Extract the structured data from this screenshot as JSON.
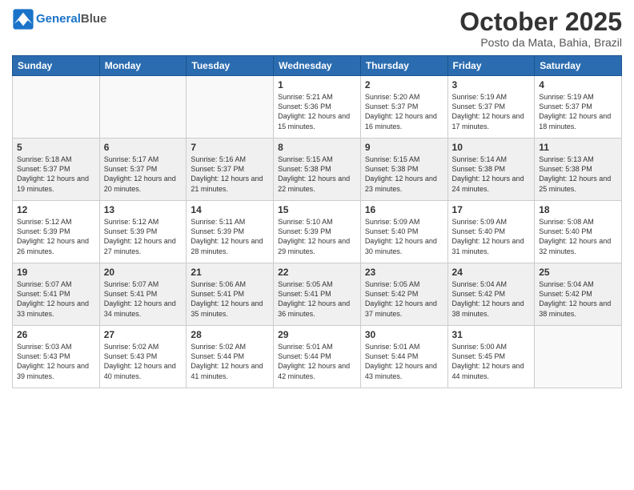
{
  "header": {
    "logo_line1": "General",
    "logo_line2": "Blue",
    "month": "October 2025",
    "location": "Posto da Mata, Bahia, Brazil"
  },
  "weekdays": [
    "Sunday",
    "Monday",
    "Tuesday",
    "Wednesday",
    "Thursday",
    "Friday",
    "Saturday"
  ],
  "weeks": [
    [
      {
        "day": "",
        "sunrise": "",
        "sunset": "",
        "daylight": ""
      },
      {
        "day": "",
        "sunrise": "",
        "sunset": "",
        "daylight": ""
      },
      {
        "day": "",
        "sunrise": "",
        "sunset": "",
        "daylight": ""
      },
      {
        "day": "1",
        "sunrise": "Sunrise: 5:21 AM",
        "sunset": "Sunset: 5:36 PM",
        "daylight": "Daylight: 12 hours and 15 minutes."
      },
      {
        "day": "2",
        "sunrise": "Sunrise: 5:20 AM",
        "sunset": "Sunset: 5:37 PM",
        "daylight": "Daylight: 12 hours and 16 minutes."
      },
      {
        "day": "3",
        "sunrise": "Sunrise: 5:19 AM",
        "sunset": "Sunset: 5:37 PM",
        "daylight": "Daylight: 12 hours and 17 minutes."
      },
      {
        "day": "4",
        "sunrise": "Sunrise: 5:19 AM",
        "sunset": "Sunset: 5:37 PM",
        "daylight": "Daylight: 12 hours and 18 minutes."
      }
    ],
    [
      {
        "day": "5",
        "sunrise": "Sunrise: 5:18 AM",
        "sunset": "Sunset: 5:37 PM",
        "daylight": "Daylight: 12 hours and 19 minutes."
      },
      {
        "day": "6",
        "sunrise": "Sunrise: 5:17 AM",
        "sunset": "Sunset: 5:37 PM",
        "daylight": "Daylight: 12 hours and 20 minutes."
      },
      {
        "day": "7",
        "sunrise": "Sunrise: 5:16 AM",
        "sunset": "Sunset: 5:37 PM",
        "daylight": "Daylight: 12 hours and 21 minutes."
      },
      {
        "day": "8",
        "sunrise": "Sunrise: 5:15 AM",
        "sunset": "Sunset: 5:38 PM",
        "daylight": "Daylight: 12 hours and 22 minutes."
      },
      {
        "day": "9",
        "sunrise": "Sunrise: 5:15 AM",
        "sunset": "Sunset: 5:38 PM",
        "daylight": "Daylight: 12 hours and 23 minutes."
      },
      {
        "day": "10",
        "sunrise": "Sunrise: 5:14 AM",
        "sunset": "Sunset: 5:38 PM",
        "daylight": "Daylight: 12 hours and 24 minutes."
      },
      {
        "day": "11",
        "sunrise": "Sunrise: 5:13 AM",
        "sunset": "Sunset: 5:38 PM",
        "daylight": "Daylight: 12 hours and 25 minutes."
      }
    ],
    [
      {
        "day": "12",
        "sunrise": "Sunrise: 5:12 AM",
        "sunset": "Sunset: 5:39 PM",
        "daylight": "Daylight: 12 hours and 26 minutes."
      },
      {
        "day": "13",
        "sunrise": "Sunrise: 5:12 AM",
        "sunset": "Sunset: 5:39 PM",
        "daylight": "Daylight: 12 hours and 27 minutes."
      },
      {
        "day": "14",
        "sunrise": "Sunrise: 5:11 AM",
        "sunset": "Sunset: 5:39 PM",
        "daylight": "Daylight: 12 hours and 28 minutes."
      },
      {
        "day": "15",
        "sunrise": "Sunrise: 5:10 AM",
        "sunset": "Sunset: 5:39 PM",
        "daylight": "Daylight: 12 hours and 29 minutes."
      },
      {
        "day": "16",
        "sunrise": "Sunrise: 5:09 AM",
        "sunset": "Sunset: 5:40 PM",
        "daylight": "Daylight: 12 hours and 30 minutes."
      },
      {
        "day": "17",
        "sunrise": "Sunrise: 5:09 AM",
        "sunset": "Sunset: 5:40 PM",
        "daylight": "Daylight: 12 hours and 31 minutes."
      },
      {
        "day": "18",
        "sunrise": "Sunrise: 5:08 AM",
        "sunset": "Sunset: 5:40 PM",
        "daylight": "Daylight: 12 hours and 32 minutes."
      }
    ],
    [
      {
        "day": "19",
        "sunrise": "Sunrise: 5:07 AM",
        "sunset": "Sunset: 5:41 PM",
        "daylight": "Daylight: 12 hours and 33 minutes."
      },
      {
        "day": "20",
        "sunrise": "Sunrise: 5:07 AM",
        "sunset": "Sunset: 5:41 PM",
        "daylight": "Daylight: 12 hours and 34 minutes."
      },
      {
        "day": "21",
        "sunrise": "Sunrise: 5:06 AM",
        "sunset": "Sunset: 5:41 PM",
        "daylight": "Daylight: 12 hours and 35 minutes."
      },
      {
        "day": "22",
        "sunrise": "Sunrise: 5:05 AM",
        "sunset": "Sunset: 5:41 PM",
        "daylight": "Daylight: 12 hours and 36 minutes."
      },
      {
        "day": "23",
        "sunrise": "Sunrise: 5:05 AM",
        "sunset": "Sunset: 5:42 PM",
        "daylight": "Daylight: 12 hours and 37 minutes."
      },
      {
        "day": "24",
        "sunrise": "Sunrise: 5:04 AM",
        "sunset": "Sunset: 5:42 PM",
        "daylight": "Daylight: 12 hours and 38 minutes."
      },
      {
        "day": "25",
        "sunrise": "Sunrise: 5:04 AM",
        "sunset": "Sunset: 5:42 PM",
        "daylight": "Daylight: 12 hours and 38 minutes."
      }
    ],
    [
      {
        "day": "26",
        "sunrise": "Sunrise: 5:03 AM",
        "sunset": "Sunset: 5:43 PM",
        "daylight": "Daylight: 12 hours and 39 minutes."
      },
      {
        "day": "27",
        "sunrise": "Sunrise: 5:02 AM",
        "sunset": "Sunset: 5:43 PM",
        "daylight": "Daylight: 12 hours and 40 minutes."
      },
      {
        "day": "28",
        "sunrise": "Sunrise: 5:02 AM",
        "sunset": "Sunset: 5:44 PM",
        "daylight": "Daylight: 12 hours and 41 minutes."
      },
      {
        "day": "29",
        "sunrise": "Sunrise: 5:01 AM",
        "sunset": "Sunset: 5:44 PM",
        "daylight": "Daylight: 12 hours and 42 minutes."
      },
      {
        "day": "30",
        "sunrise": "Sunrise: 5:01 AM",
        "sunset": "Sunset: 5:44 PM",
        "daylight": "Daylight: 12 hours and 43 minutes."
      },
      {
        "day": "31",
        "sunrise": "Sunrise: 5:00 AM",
        "sunset": "Sunset: 5:45 PM",
        "daylight": "Daylight: 12 hours and 44 minutes."
      },
      {
        "day": "",
        "sunrise": "",
        "sunset": "",
        "daylight": ""
      }
    ]
  ]
}
